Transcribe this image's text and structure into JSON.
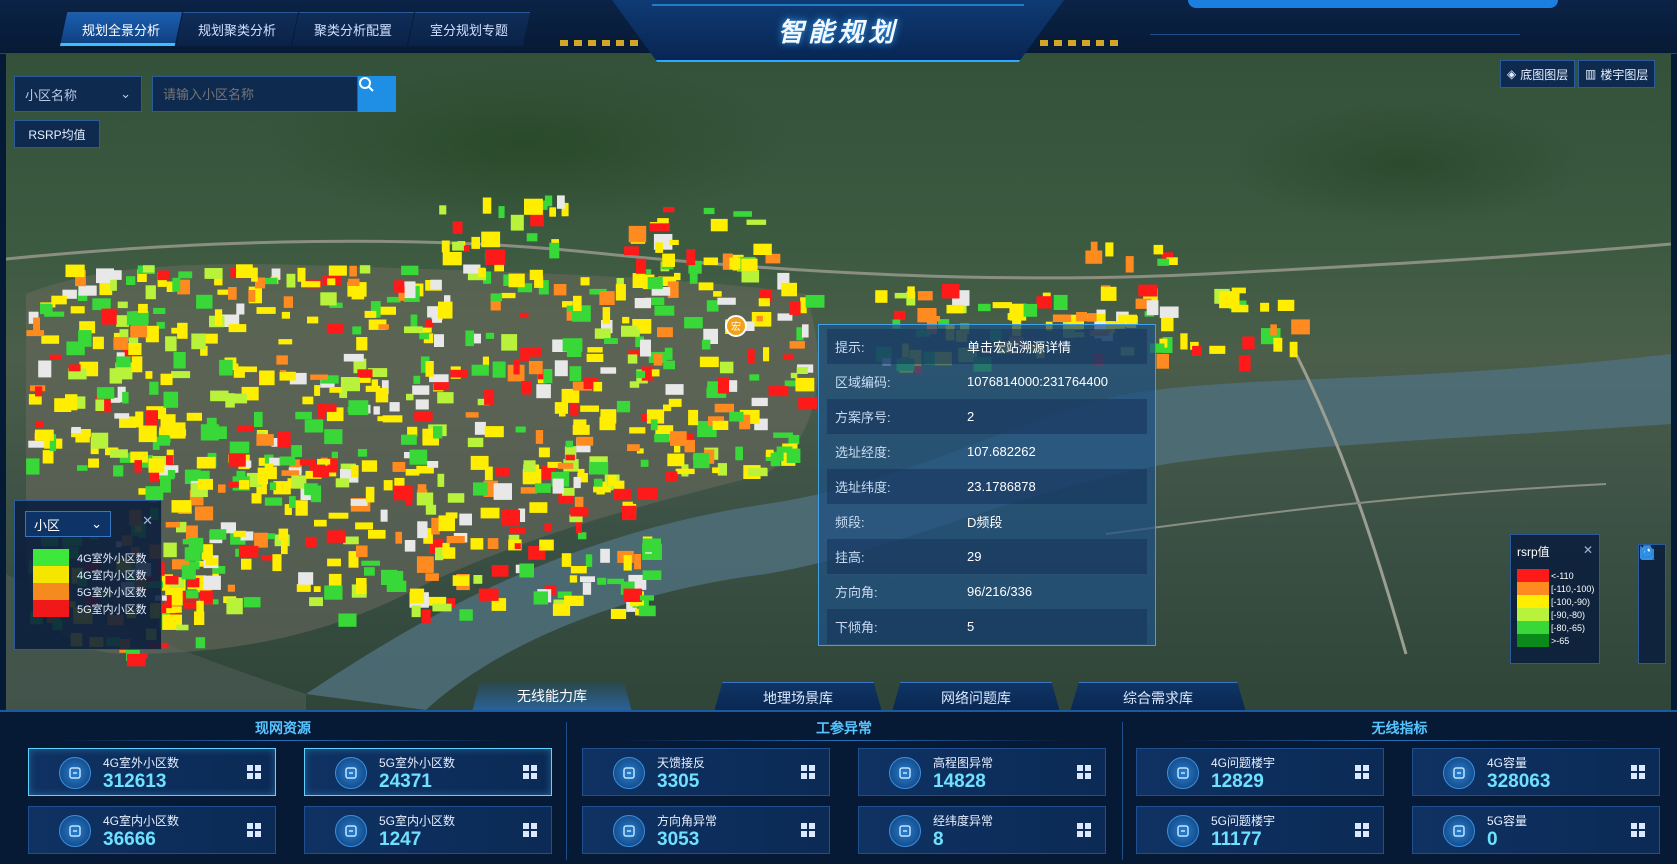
{
  "header": {
    "title": "智能规划",
    "tabs": [
      {
        "label": "规划全景分析",
        "active": true
      },
      {
        "label": "规划聚类分析",
        "active": false
      },
      {
        "label": "聚类分析配置",
        "active": false
      },
      {
        "label": "室分规划专题",
        "active": false
      }
    ]
  },
  "map": {
    "cell_select": "小区名称",
    "search_placeholder": "请输入小区名称",
    "rsrp_button": "RSRP均值",
    "layers": [
      "底图图层",
      "楼宇图层"
    ],
    "marker_label": "宏",
    "legend_left": {
      "select": "小区",
      "items": [
        {
          "label": "4G室外小区数",
          "color": "#3ee83a"
        },
        {
          "label": "4G室内小区数",
          "color": "#f5e600"
        },
        {
          "label": "5G室外小区数",
          "color": "#f58a1f"
        },
        {
          "label": "5G室内小区数",
          "color": "#f01818"
        }
      ]
    },
    "legend_right": {
      "title": "rsrp值",
      "items": [
        {
          "label": "<-110",
          "color": "#ff1a1a"
        },
        {
          "label": "[-110,-100)",
          "color": "#ff8a1f"
        },
        {
          "label": "[-100,-90)",
          "color": "#ffee00"
        },
        {
          "label": "[-90,-80)",
          "color": "#b8f23a"
        },
        {
          "label": "[-80,-65)",
          "color": "#38d838"
        },
        {
          "label": ">-65",
          "color": "#0a8a1a"
        }
      ]
    },
    "popup": [
      {
        "k": "提示:",
        "v": "单击宏站溯源详情"
      },
      {
        "k": "区域编码:",
        "v": "1076814000:231764400"
      },
      {
        "k": "方案序号:",
        "v": "2"
      },
      {
        "k": "选址经度:",
        "v": "107.682262"
      },
      {
        "k": "选址纬度:",
        "v": "23.1786878"
      },
      {
        "k": "频段:",
        "v": "D频段"
      },
      {
        "k": "挂高:",
        "v": "29"
      },
      {
        "k": "方向角:",
        "v": "96/216/336"
      },
      {
        "k": "下倾角:",
        "v": "5"
      }
    ],
    "bottom_tabs": [
      {
        "label": "无线能力库",
        "active": true
      },
      {
        "label": "地理场景库",
        "active": false
      },
      {
        "label": "网络问题库",
        "active": false
      },
      {
        "label": "综合需求库",
        "active": false
      }
    ]
  },
  "panels": [
    {
      "title": "现网资源",
      "cards": [
        {
          "label": "4G室外小区数",
          "value": "312613",
          "selected": true
        },
        {
          "label": "5G室外小区数",
          "value": "24371",
          "selected": true
        },
        {
          "label": "4G室内小区数",
          "value": "36666",
          "selected": false
        },
        {
          "label": "5G室内小区数",
          "value": "1247",
          "selected": false
        }
      ]
    },
    {
      "title": "工参异常",
      "cards": [
        {
          "label": "天馈接反",
          "value": "3305",
          "selected": false
        },
        {
          "label": "高程图异常",
          "value": "14828",
          "selected": false
        },
        {
          "label": "方向角异常",
          "value": "3053",
          "selected": false
        },
        {
          "label": "经纬度异常",
          "value": "8",
          "selected": false
        }
      ]
    },
    {
      "title": "无线指标",
      "cards": [
        {
          "label": "4G问题楼宇",
          "value": "12829",
          "selected": false
        },
        {
          "label": "4G容量",
          "value": "328063",
          "selected": false
        },
        {
          "label": "5G问题楼宇",
          "value": "11177",
          "selected": false
        },
        {
          "label": "5G容量",
          "value": "0",
          "selected": false
        }
      ]
    }
  ]
}
